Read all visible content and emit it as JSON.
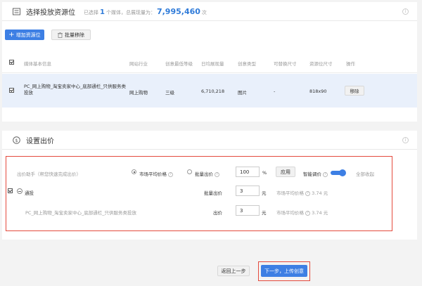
{
  "section1": {
    "title": "选择投放资源位",
    "summary_prefix": "已选择",
    "selected_count": "1",
    "summary_mid": "个媒体，总展现量为：",
    "total_impressions": "7,995,460",
    "summary_suffix": "次",
    "add_button": "增加资源位",
    "batch_remove_button": "批量移除"
  },
  "table": {
    "headers": [
      "媒体基本信息",
      "网站行业",
      "创意最低等级",
      "日均展现量",
      "创意类型",
      "可替换尺寸",
      "资源位尺寸",
      "操作"
    ],
    "rows": [
      {
        "media": "PC_网上购物_淘宝卖家中心_底部通栏_只供服务类投放",
        "industry": "网上购物",
        "level": "三级",
        "daily_impressions": "6,710,218",
        "creative_type": "图片",
        "replaceable_size": "-",
        "slot_size": "818x90",
        "action": "移除"
      }
    ]
  },
  "section2": {
    "title": "设置出价",
    "helper_label": "出价助手（帮您快速完成出价）",
    "market_price_option": "市场平均价格",
    "batch_bid_option": "批量出价",
    "percent_value": "100",
    "percent_unit": "%",
    "apply_button": "应用",
    "smart_bid_label": "智能调价",
    "collapse_all": "全部收起",
    "group_name": "通投",
    "batch_bid_label": "批量出价",
    "group_bid_value": "3",
    "currency_unit": "元",
    "market_avg_label": "市场平均价格",
    "market_avg_value": "3.74 元",
    "slot_name": "PC_网上购物_淘宝卖家中心_底部通栏_只供服务类投放",
    "bid_label": "出价",
    "slot_bid_value": "3"
  },
  "footer": {
    "prev_button": "返回上一步",
    "next_button": "下一步，上传创意"
  },
  "colors": {
    "primary": "#3d7fe4",
    "highlight_border": "#e44a3d",
    "selected_row_bg": "#e9f0fb"
  }
}
